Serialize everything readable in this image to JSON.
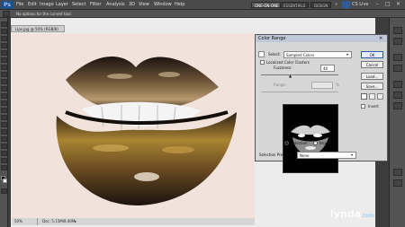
{
  "app": {
    "logo": "Ps",
    "menus": [
      "File",
      "Edit",
      "Image",
      "Layer",
      "Select",
      "Filter",
      "Analysis",
      "3D",
      "View",
      "Window",
      "Help"
    ],
    "workspaces": [
      "ONE-ON-ONE",
      "ESSENTIALS",
      "DESIGN"
    ],
    "cs_live": "CS Live",
    "hint": "No options for the current tool."
  },
  "document": {
    "tab_title": "Lips.jpg @ 50% (RGB/8)",
    "zoom": "50%",
    "doc_info": "Doc: 5.15M/8.40M"
  },
  "color_range": {
    "title": "Color Range",
    "select_label": "Select:",
    "select_value": "Sampled Colors",
    "localized_label": "Localized Color Clusters",
    "fuzziness_label": "Fuzziness:",
    "fuzziness_value": "40",
    "range_label": "Range:",
    "range_unit": "%",
    "selection_option": "Selection",
    "image_option": "Image",
    "selection_preview_label": "Selection Preview:",
    "selection_preview_value": "None",
    "ok_label": "OK",
    "cancel_label": "Cancel",
    "load_label": "Load...",
    "save_label": "Save...",
    "invert_label": "Invert"
  },
  "watermark": {
    "brand": "lynda",
    "suffix": ".com"
  }
}
